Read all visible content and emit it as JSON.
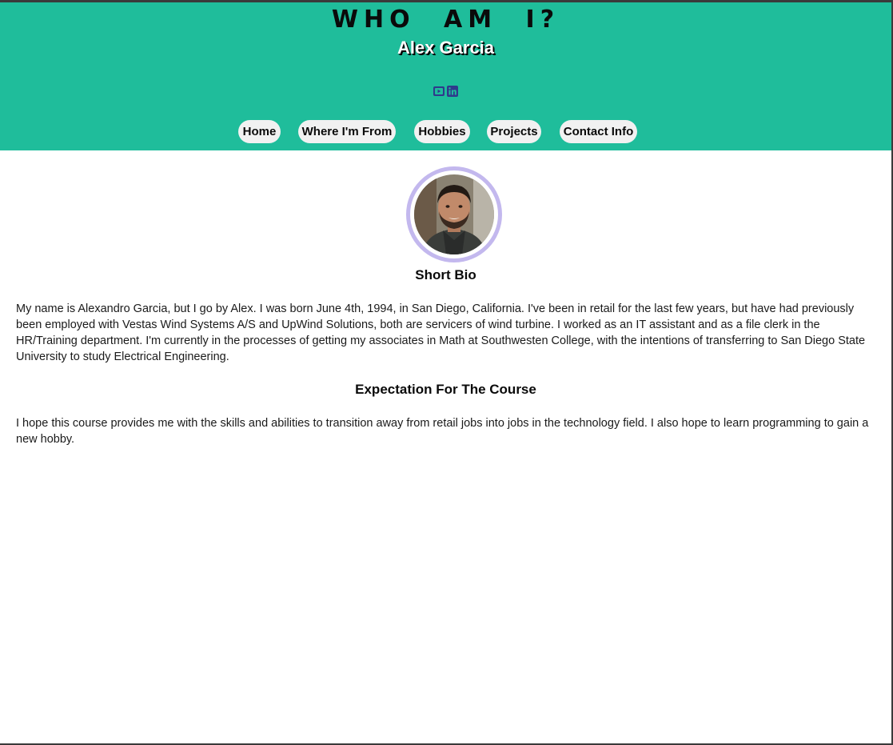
{
  "header": {
    "title": "WHO AM I?",
    "name": "Alex Garcia",
    "social": [
      {
        "icon": "youtube-icon",
        "color": "#2f3a8c"
      },
      {
        "icon": "linkedin-icon",
        "color": "#2f3a8c"
      }
    ],
    "background_color": "#1fbd9b"
  },
  "nav": {
    "items": [
      {
        "label": "Home"
      },
      {
        "label": "Where I'm From"
      },
      {
        "label": "Hobbies"
      },
      {
        "label": "Projects"
      },
      {
        "label": "Contact Info"
      }
    ]
  },
  "profile": {
    "ring_color": "#c3b8ee"
  },
  "bio": {
    "heading": "Short Bio",
    "text": "My name is Alexandro Garcia, but I go by Alex. I was born June 4th, 1994, in San Diego, California. I've been in retail for the last few years, but have had previously been employed with Vestas Wind Systems A/S and UpWind Solutions, both are servicers of wind turbine. I worked as an IT assistant and as a file clerk in the HR/Training department. I'm currently in the processes of getting my associates in Math at Southwesten College, with the intentions of transferring to San Diego State University to study Electrical Engineering."
  },
  "expectation": {
    "heading": "Expectation For The Course",
    "text": "I hope this course provides me with the skills and abilities to transition away from retail jobs into jobs in the technology field. I also hope to learn programming to gain a new hobby."
  }
}
